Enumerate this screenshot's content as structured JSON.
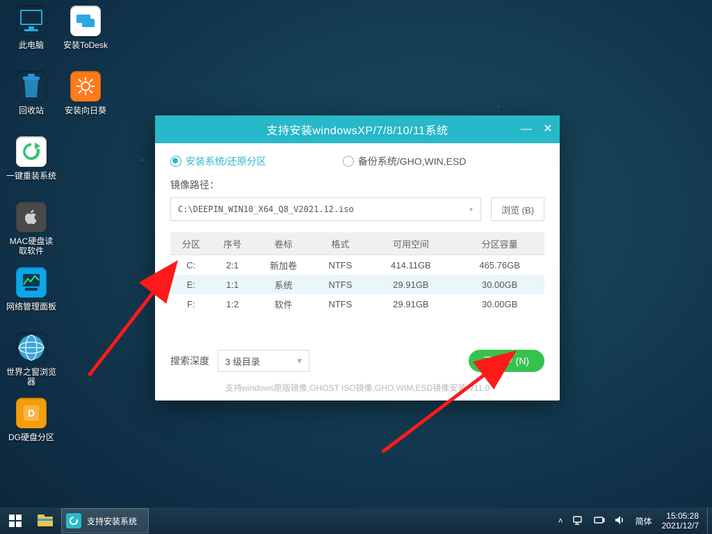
{
  "desktop_icons_col1": [
    {
      "name": "此电脑",
      "tile": "t-pc"
    },
    {
      "name": "回收站",
      "tile": "t-recycle"
    },
    {
      "name": "一键重装系统",
      "tile": "t-reinstall"
    },
    {
      "name": "MAC硬盘读取软件",
      "tile": "t-mac"
    },
    {
      "name": "网络管理面板",
      "tile": "t-net"
    },
    {
      "name": "世界之窗浏览器",
      "tile": "t-browser"
    },
    {
      "name": "DG硬盘分区",
      "tile": "t-dg"
    }
  ],
  "desktop_icons_col2": [
    {
      "name": "安装ToDesk",
      "tile": "t-todesk"
    },
    {
      "name": "安装向日葵",
      "tile": "t-sunflower"
    }
  ],
  "window": {
    "title": "支持安装windowsXP/7/8/10/11系统",
    "mode_install": "安装系统/还原分区",
    "mode_backup": "备份系统/GHO,WIN,ESD",
    "path_label": "镜像路径：",
    "path_value": "C:\\DEEPIN_WIN10_X64_Q8_V2021.12.iso",
    "browse": "浏览 (B)",
    "table": {
      "headers": [
        "分区",
        "序号",
        "卷标",
        "格式",
        "可用空间",
        "分区容量"
      ],
      "rows": [
        {
          "part": "C:",
          "idx": "2:1",
          "label": "新加卷",
          "fs": "NTFS",
          "free": "414.11GB",
          "cap": "465.76GB",
          "selected": false
        },
        {
          "part": "E:",
          "idx": "1:1",
          "label": "系统",
          "fs": "NTFS",
          "free": "29.91GB",
          "cap": "30.00GB",
          "selected": true
        },
        {
          "part": "F:",
          "idx": "1:2",
          "label": "软件",
          "fs": "NTFS",
          "free": "29.91GB",
          "cap": "30.00GB",
          "selected": false
        }
      ]
    },
    "depth_label": "搜索深度",
    "depth_value": "3 级目录",
    "next": "下一步 (N)",
    "support_line": "支持windows原版镜像,GHOST ISO镜像,GHO,WIM,ESD镜像安装 V11.0"
  },
  "taskbar": {
    "task_label": "支持安装系统",
    "ime": "简体",
    "time": "15:05:28",
    "date": "2021/12/7"
  }
}
